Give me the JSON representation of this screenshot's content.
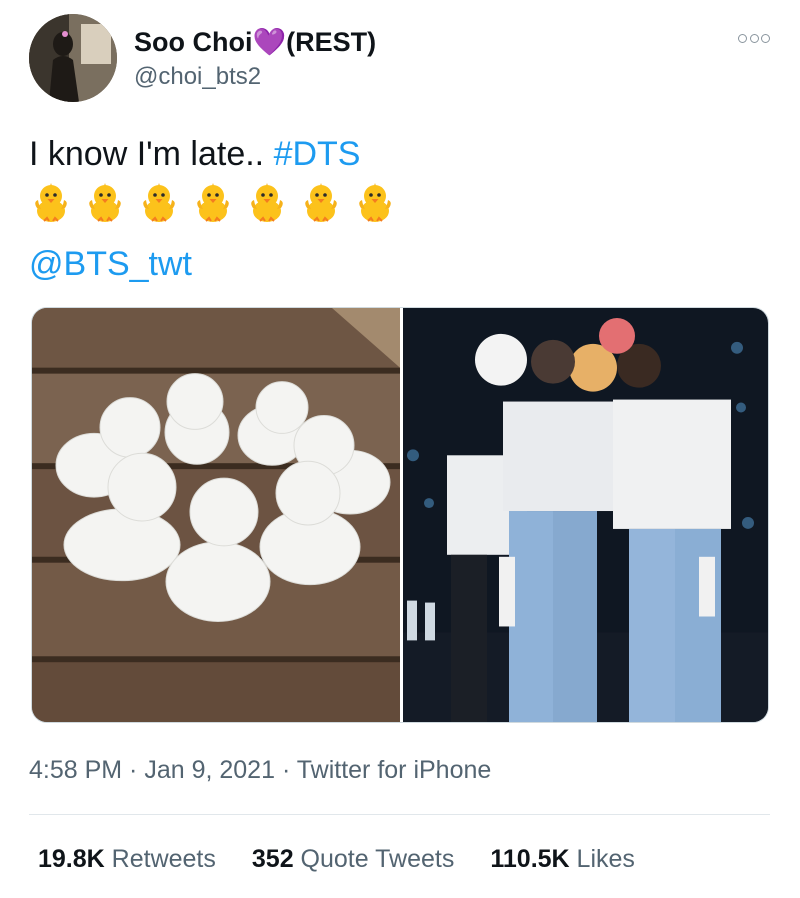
{
  "author": {
    "display_name": "Soo Choi",
    "heart": "💜",
    "status": "(REST)",
    "handle": "@choi_bts2"
  },
  "tweet": {
    "text": "I know I'm late.. ",
    "hashtag": "#DTS",
    "chick_count": 7,
    "mention": "@BTS_twt"
  },
  "meta": {
    "time": "4:58 PM",
    "separator1": " · ",
    "date": "Jan 9, 2021",
    "separator2": " · ",
    "source": "Twitter for iPhone"
  },
  "stats": {
    "retweets_count": "19.8K",
    "retweets_label": " Retweets",
    "quotes_count": "352",
    "quotes_label": " Quote Tweets",
    "likes_count": "110.5K",
    "likes_label": " Likes"
  },
  "icons": {
    "more": "more-dots-icon",
    "emoji": "baby-chick-icon"
  },
  "colors": {
    "link": "#1d9bf0",
    "muted": "#536471",
    "heart": "#a98ad6"
  }
}
